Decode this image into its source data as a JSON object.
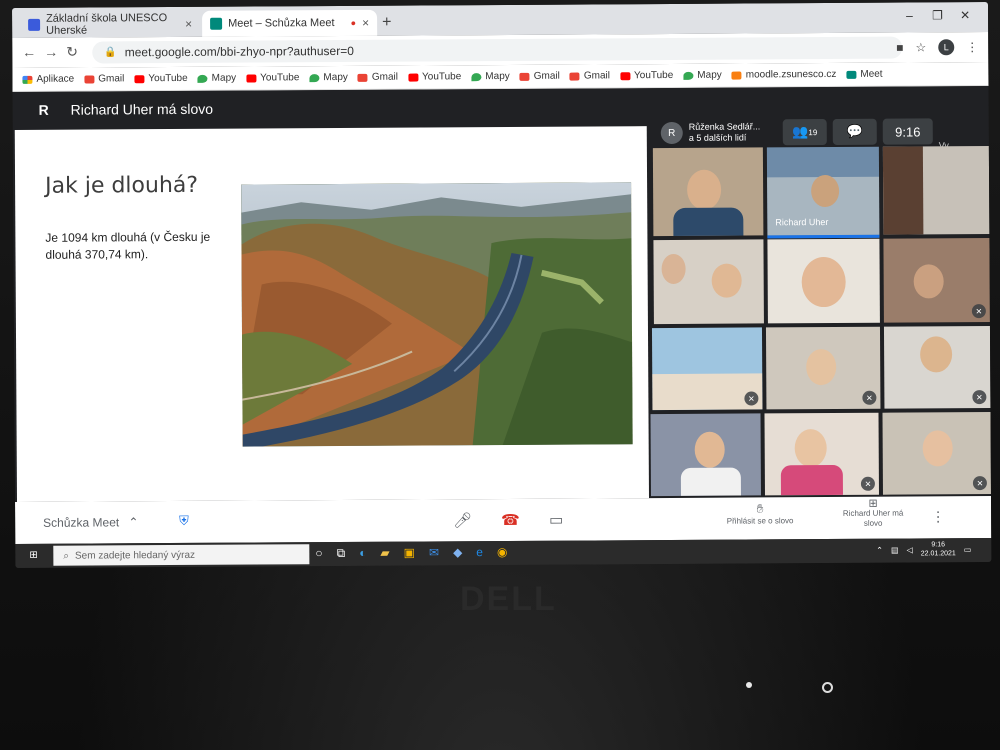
{
  "browser": {
    "tabs": [
      {
        "title": "Základní škola UNESCO Uherské",
        "close": "×"
      },
      {
        "title": "Meet – Schůzka Meet",
        "close": "×"
      }
    ],
    "new_tab": "+",
    "url": "meet.google.com/bbi-zhyo-npr?authuser=0",
    "profile_initial": "L",
    "bookmarks": [
      {
        "label": "Aplikace",
        "icon": "apps-grid",
        "color": "#ea4335"
      },
      {
        "label": "Gmail",
        "icon": "gmail",
        "color": "#ea4335"
      },
      {
        "label": "YouTube",
        "icon": "youtube",
        "color": "#ff0000"
      },
      {
        "label": "Mapy",
        "icon": "maps-pin",
        "color": "#34a853"
      },
      {
        "label": "YouTube",
        "icon": "youtube",
        "color": "#ff0000"
      },
      {
        "label": "Mapy",
        "icon": "maps-pin",
        "color": "#34a853"
      },
      {
        "label": "Gmail",
        "icon": "gmail",
        "color": "#ea4335"
      },
      {
        "label": "YouTube",
        "icon": "youtube",
        "color": "#ff0000"
      },
      {
        "label": "Mapy",
        "icon": "maps-pin",
        "color": "#34a853"
      },
      {
        "label": "Gmail",
        "icon": "gmail",
        "color": "#ea4335"
      },
      {
        "label": "Gmail",
        "icon": "gmail",
        "color": "#ea4335"
      },
      {
        "label": "YouTube",
        "icon": "youtube",
        "color": "#ff0000"
      },
      {
        "label": "Mapy",
        "icon": "maps-pin",
        "color": "#34a853"
      },
      {
        "label": "moodle.zsunesco.cz",
        "icon": "moodle",
        "color": "#f98012"
      },
      {
        "label": "Meet",
        "icon": "meet",
        "color": "#00897b"
      }
    ]
  },
  "meet": {
    "presenter_initial": "R",
    "presenting_title": "Richard Uher má slovo",
    "participants_chip": {
      "initial": "R",
      "line1": "Růženka Sedlář...",
      "line2": "a 5 dalších lidí"
    },
    "participant_count": "19",
    "time": "9:16",
    "self_label": "Vy",
    "active_speaker_name": "Richard Uher",
    "meeting_name": "Schůzka Meet",
    "raise_hand_label": "Přihlásit se o slovo",
    "presenting_button": "Richard Uher má slovo"
  },
  "slide": {
    "heading": "Jak je dlouhá?",
    "body": "Je 1094 km dlouhá (v Česku je dlouhá 370,74 km)."
  },
  "taskbar": {
    "search_placeholder": "Sem zadejte hledaný výraz",
    "time": "9:16",
    "date": "22.01.2021"
  },
  "laptop": {
    "brand": "DELL"
  }
}
